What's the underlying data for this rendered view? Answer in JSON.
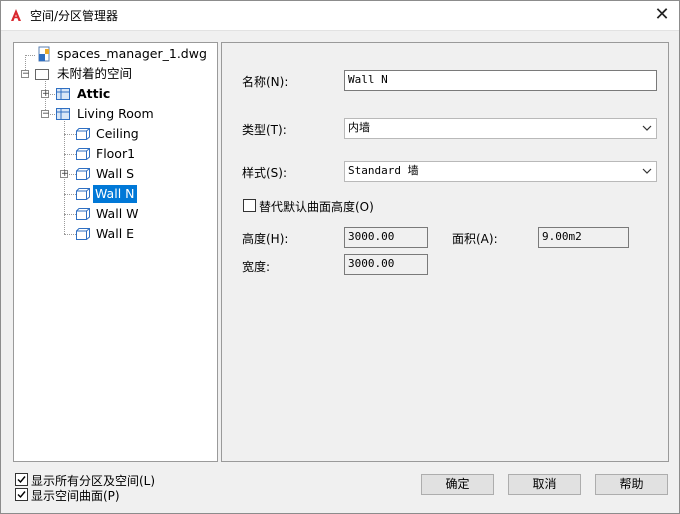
{
  "window": {
    "title": "空间/分区管理器",
    "close_glyph": "✕"
  },
  "tree": {
    "root": "spaces_manager_1.dwg",
    "unattached": "未附着的空间",
    "nodes": [
      {
        "label": "Attic"
      },
      {
        "label": "Living Room"
      },
      {
        "label": "Ceiling"
      },
      {
        "label": "Floor1"
      },
      {
        "label": "Wall S"
      },
      {
        "label": "Wall N"
      },
      {
        "label": "Wall W"
      },
      {
        "label": "Wall E"
      }
    ],
    "selected": "Wall N"
  },
  "form": {
    "name_label": "名称(N):",
    "name_value": "Wall N",
    "type_label": "类型(T):",
    "type_value": "内墙",
    "style_label": "样式(S):",
    "style_value": "Standard 墙",
    "override_label": "替代默认曲面高度(O)",
    "height_label": "高度(H):",
    "height_value": "3000.00",
    "area_label": "面积(A):",
    "area_value": "9.00m2",
    "width_label": "宽度:",
    "width_value": "3000.00"
  },
  "footer": {
    "show_all_label": "显示所有分区及空间(L)",
    "show_surfaces_label": "显示空间曲面(P)",
    "ok_label": "确定",
    "cancel_label": "取消",
    "help_label": "帮助"
  },
  "colors": {
    "selection": "#0078d7",
    "app_icon": "#d9282f"
  }
}
